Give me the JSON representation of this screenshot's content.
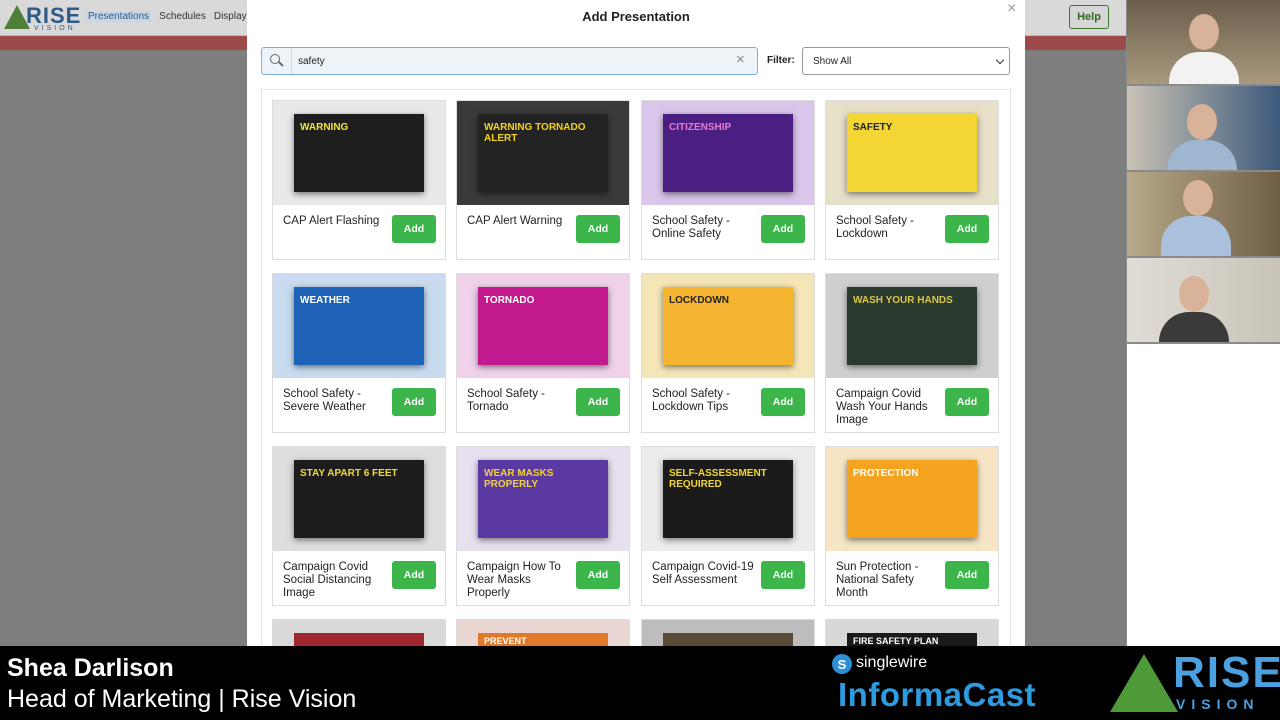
{
  "app": {
    "logo_text": "RISE",
    "logo_sub": "VISION",
    "nav": [
      "Presentations",
      "Schedules",
      "Displays"
    ],
    "help_label": "Help"
  },
  "modal": {
    "title": "Add Presentation",
    "close_icon": "close-icon",
    "search_value": "safety",
    "filter_label": "Filter:",
    "filter_value": "Show All"
  },
  "cards": [
    {
      "name": "CAP Alert Flashing",
      "add": "Add",
      "thumb": {
        "bg": "#e9e9e9",
        "screen": "#1e1e1e",
        "accent": "#f2e33a",
        "headline": "WARNING"
      }
    },
    {
      "name": "CAP Alert Warning",
      "add": "Add",
      "thumb": {
        "bg": "#3a3a3a",
        "screen": "#232323",
        "accent": "#f3d21a",
        "headline": "WARNING TORNADO ALERT"
      }
    },
    {
      "name": "School Safety - Online Safety",
      "add": "Add",
      "thumb": {
        "bg": "#d9c6ea",
        "screen": "#4b1f82",
        "accent": "#e87bd1",
        "headline": "CITIZENSHIP"
      }
    },
    {
      "name": "School Safety - Lockdown",
      "add": "Add",
      "thumb": {
        "bg": "#e6e0c8",
        "screen": "#f3d533",
        "accent": "#222222",
        "headline": "SAFETY"
      }
    },
    {
      "name": "School Safety - Severe Weather",
      "add": "Add",
      "thumb": {
        "bg": "#c9dcef",
        "screen": "#1e63b8",
        "accent": "#ffffff",
        "headline": "WEATHER"
      }
    },
    {
      "name": "School Safety - Tornado",
      "add": "Add",
      "thumb": {
        "bg": "#efd2ea",
        "screen": "#c2198f",
        "accent": "#ffffff",
        "headline": "TORNADO"
      }
    },
    {
      "name": "School Safety - Lockdown Tips",
      "add": "Add",
      "thumb": {
        "bg": "#f5e6b8",
        "screen": "#f5b530",
        "accent": "#222222",
        "headline": "LOCKDOWN"
      }
    },
    {
      "name": "Campaign Covid Wash Your Hands Image",
      "add": "Add",
      "thumb": {
        "bg": "#cfcfcf",
        "screen": "#2b3a2f",
        "accent": "#d7c64a",
        "headline": "WASH YOUR HANDS"
      }
    },
    {
      "name": "Campaign Covid Social Distancing Image",
      "add": "Add",
      "thumb": {
        "bg": "#dedede",
        "screen": "#1d1d1d",
        "accent": "#f2d93a",
        "headline": "STAY APART 6 FEET"
      }
    },
    {
      "name": "Campaign How To Wear Masks Properly",
      "add": "Add",
      "thumb": {
        "bg": "#e6e0ef",
        "screen": "#5a3aa2",
        "accent": "#f2d23a",
        "headline": "WEAR MASKS PROPERLY"
      }
    },
    {
      "name": "Campaign Covid-19 Self Assessment",
      "add": "Add",
      "thumb": {
        "bg": "#ececec",
        "screen": "#1b1b1b",
        "accent": "#f3d633",
        "headline": "SELF-ASSESSMENT REQUIRED"
      }
    },
    {
      "name": "Sun Protection - National Safety Month",
      "add": "Add",
      "thumb": {
        "bg": "#f6e6c6",
        "screen": "#f3a320",
        "accent": "#ffffff",
        "headline": "PROTECTION"
      }
    }
  ],
  "peek_cards": [
    {
      "bg": "#d9d9d9",
      "screen": "#a0262f",
      "headline": ""
    },
    {
      "bg": "#ead7d3",
      "screen": "#e07a2a",
      "headline": "PREVENT"
    },
    {
      "bg": "#bdbdbd",
      "screen": "#5a4a3a",
      "headline": ""
    },
    {
      "bg": "#d7d7d7",
      "screen": "#1a1a1a",
      "headline": "FIRE SAFETY PLAN"
    }
  ],
  "caption": {
    "name": "Shea Darlison",
    "title": "Head of Marketing | Rise Vision",
    "singlewire": "singlewire",
    "singlewire_icon": "S",
    "informacast": "InformaCast",
    "rise": "RISE",
    "rise_sub": "VISION"
  },
  "colors": {
    "add_green": "#3cb64a",
    "informacast_blue": "#2d9be0",
    "rise_green": "#4f9a38"
  }
}
